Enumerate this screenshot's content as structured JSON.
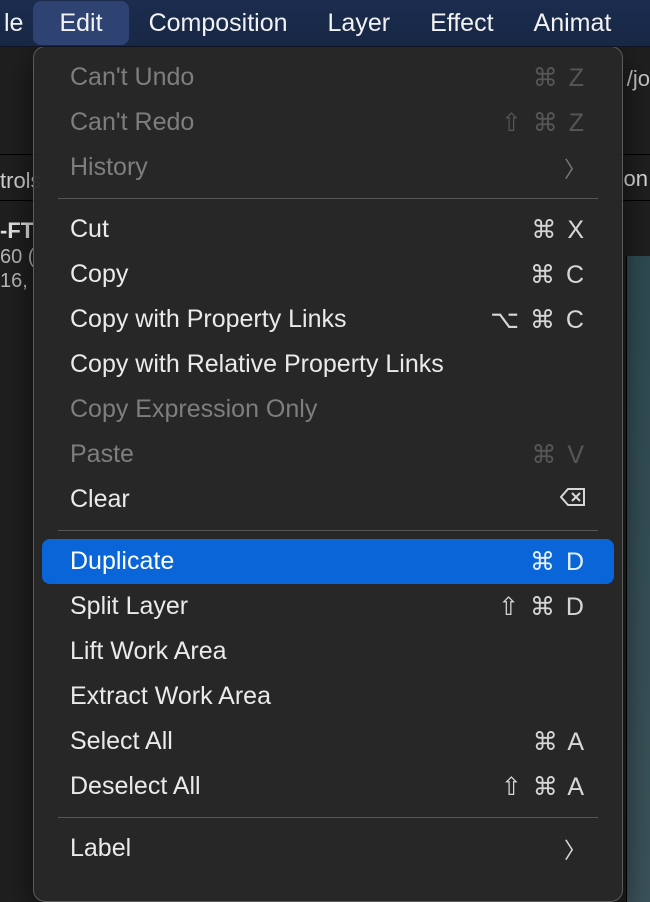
{
  "menubar": {
    "file_partial": "le",
    "edit": "Edit",
    "composition": "Composition",
    "layer": "Layer",
    "effect": "Effect",
    "animation_partial": "Animat"
  },
  "background": {
    "titlebar_partial": "/jo",
    "panel_tab_right_partial": "on",
    "left_trols": "trols",
    "left_ft": "-FT",
    "left_60": "60 (",
    "left_16": "16,"
  },
  "menu": {
    "undo": {
      "label": "Can't Undo",
      "shortcut": "⌘ Z"
    },
    "redo": {
      "label": "Can't Redo",
      "shortcut": "⇧ ⌘ Z"
    },
    "history": {
      "label": "History"
    },
    "cut": {
      "label": "Cut",
      "shortcut": "⌘ X"
    },
    "copy": {
      "label": "Copy",
      "shortcut": "⌘ C"
    },
    "copy_prop_links": {
      "label": "Copy with Property Links",
      "shortcut": "⌥ ⌘ C"
    },
    "copy_rel_links": {
      "label": "Copy with Relative Property Links"
    },
    "copy_expr": {
      "label": "Copy Expression Only"
    },
    "paste": {
      "label": "Paste",
      "shortcut": "⌘ V"
    },
    "clear": {
      "label": "Clear"
    },
    "duplicate": {
      "label": "Duplicate",
      "shortcut": "⌘ D"
    },
    "split": {
      "label": "Split Layer",
      "shortcut": "⇧ ⌘ D"
    },
    "lift": {
      "label": "Lift Work Area"
    },
    "extract": {
      "label": "Extract Work Area"
    },
    "select_all": {
      "label": "Select All",
      "shortcut": "⌘ A"
    },
    "deselect_all": {
      "label": "Deselect All",
      "shortcut": "⇧ ⌘ A"
    },
    "label": {
      "label": "Label"
    }
  }
}
